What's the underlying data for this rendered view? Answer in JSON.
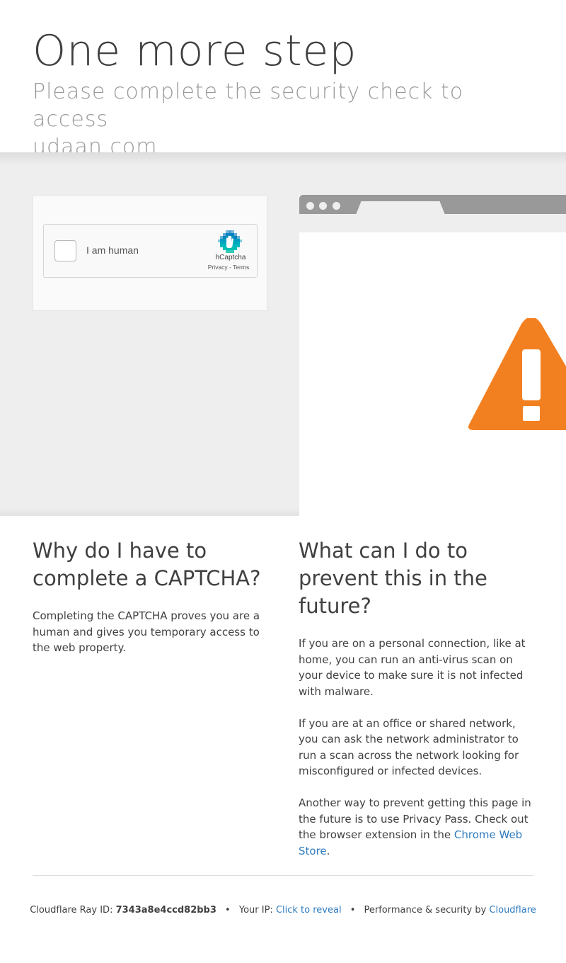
{
  "header": {
    "title": "One more step",
    "subtitle": "Please complete the security check to access",
    "domain": "udaan.com"
  },
  "captcha": {
    "label": "I am human",
    "brand": "hCaptcha",
    "privacy": "Privacy",
    "separator": " - ",
    "terms": "Terms"
  },
  "illustration": {
    "icon": "warning-triangle-icon",
    "warning_color": "#f38020"
  },
  "why": {
    "heading": "Why do I have to complete a CAPTCHA?",
    "body": "Completing the CAPTCHA proves you are a human and gives you temporary access to the web property."
  },
  "what": {
    "heading": "What can I do to prevent this in the future?",
    "p1": "If you are on a personal connection, like at home, you can run an anti-virus scan on your device to make sure it is not infected with malware.",
    "p2": "If you are at an office or shared network, you can ask the network administrator to run a scan across the network looking for misconfigured or infected devices.",
    "p3_before": "Another way to prevent getting this page in the future is to use Privacy Pass. Check out the browser extension in the ",
    "p3_link": "Chrome Web Store",
    "p3_after": "."
  },
  "footer": {
    "ray_label": "Cloudflare Ray ID: ",
    "ray_id": "7343a8e4ccd82bb3",
    "bullet": "•",
    "ip_label": "Your IP: ",
    "ip_link": "Click to reveal",
    "perf_label": "Performance & security by ",
    "perf_link": "Cloudflare"
  },
  "colors": {
    "link": "#2f7bbf",
    "text": "#404040",
    "subtitle": "#999999"
  }
}
